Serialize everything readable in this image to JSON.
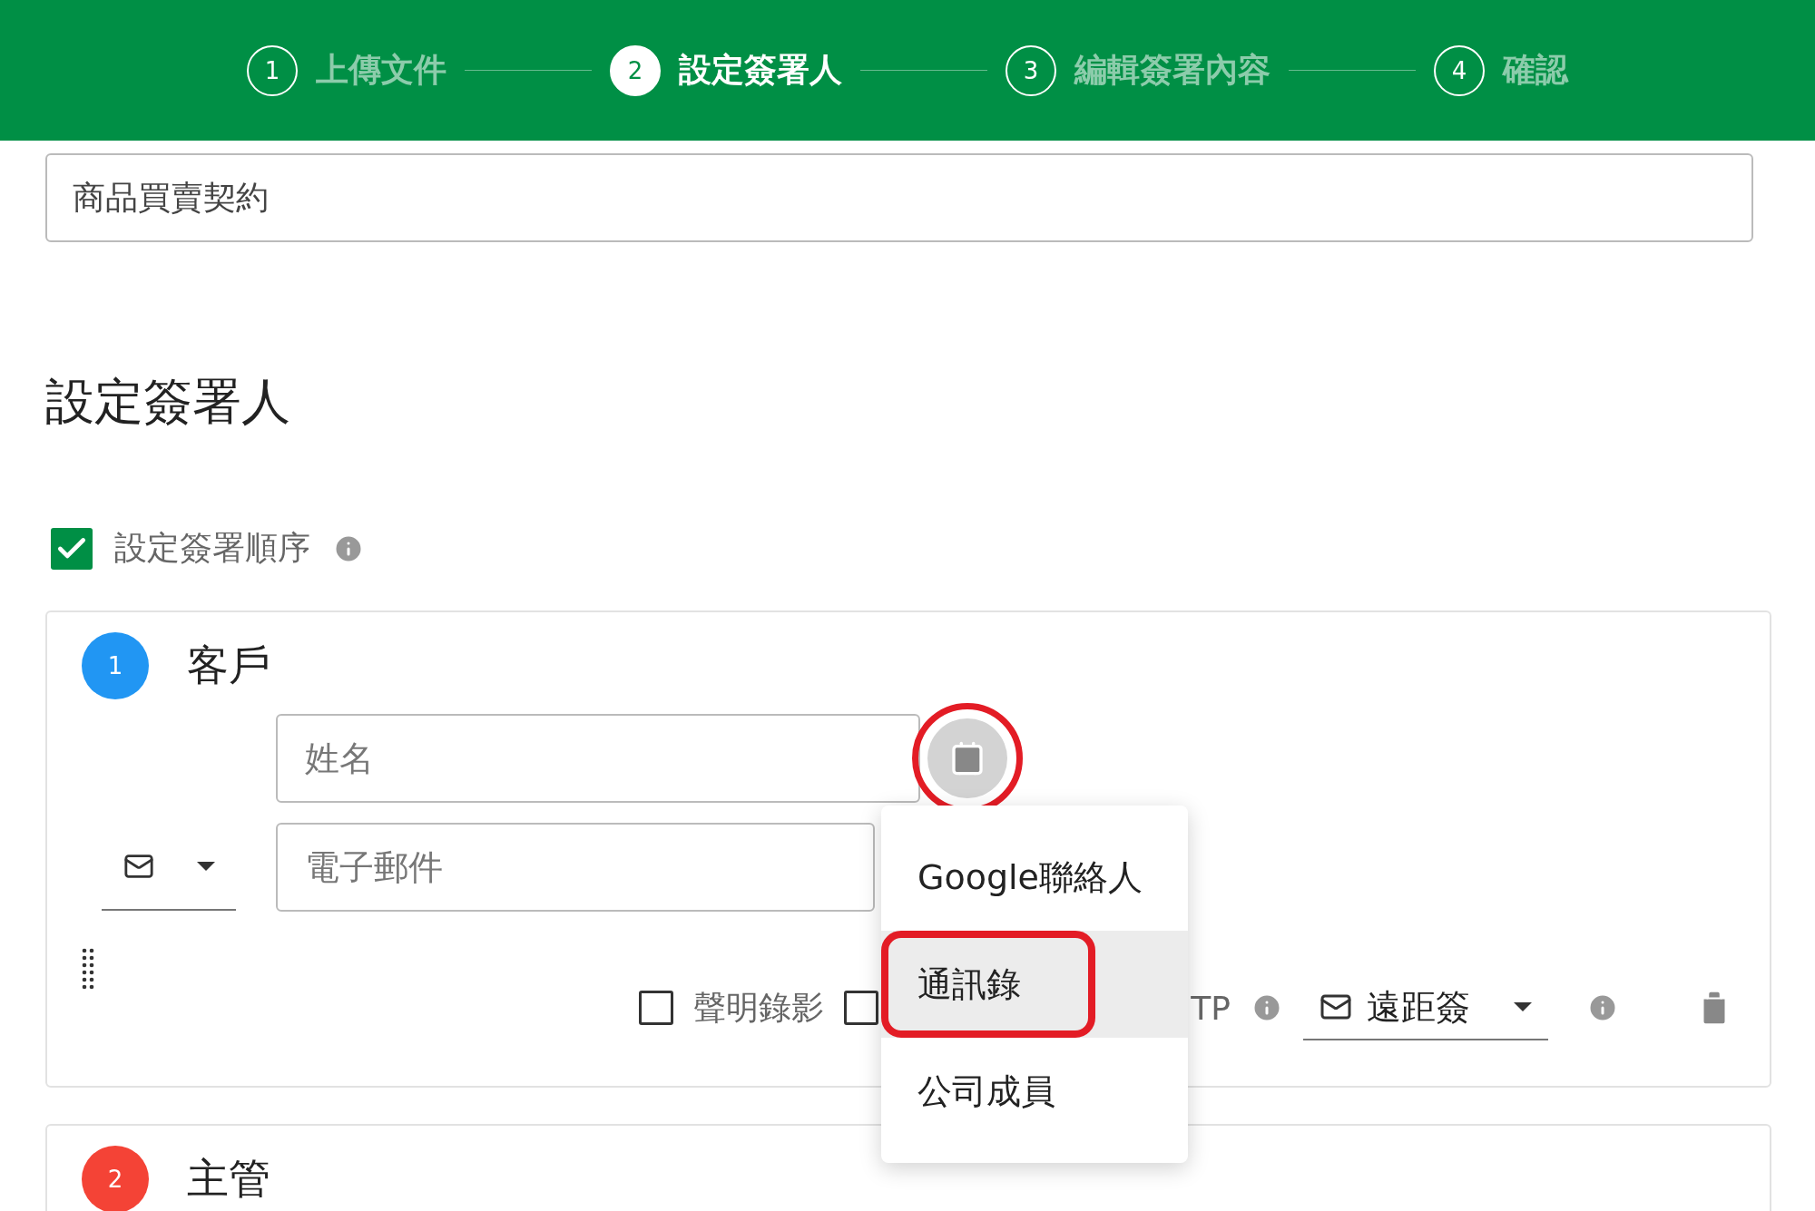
{
  "stepper": [
    {
      "number": "1",
      "label": "上傳文件",
      "selected": false
    },
    {
      "number": "2",
      "label": "設定簽署人",
      "selected": true
    },
    {
      "number": "3",
      "label": "編輯簽署內容",
      "selected": false
    },
    {
      "number": "4",
      "label": "確認",
      "selected": false
    }
  ],
  "document_title": {
    "value": "商品買賣契約"
  },
  "heading": "設定簽署人",
  "signing_order": {
    "label": "設定簽署順序",
    "checked": true
  },
  "signers": [
    {
      "number": "1",
      "role": "客戶",
      "color": "#2196f3",
      "name_field": {
        "placeholder": "姓名"
      },
      "email_field": {
        "placeholder": "電子郵件"
      },
      "contacts_button": {
        "highlighted": true
      },
      "options": [
        {
          "label": "聲明錄影",
          "checked": false
        },
        {
          "checked": false
        }
      ],
      "otp_label": "TP",
      "sign_method": "遠距簽"
    },
    {
      "number": "2",
      "role": "主管",
      "color": "#f44336"
    }
  ],
  "contacts_menu": {
    "items": [
      {
        "label": "Google聯絡人",
        "selected": false,
        "highlighted": false
      },
      {
        "label": "通訊錄",
        "selected": true,
        "highlighted": true
      },
      {
        "label": "公司成員",
        "selected": false,
        "highlighted": false
      }
    ]
  }
}
